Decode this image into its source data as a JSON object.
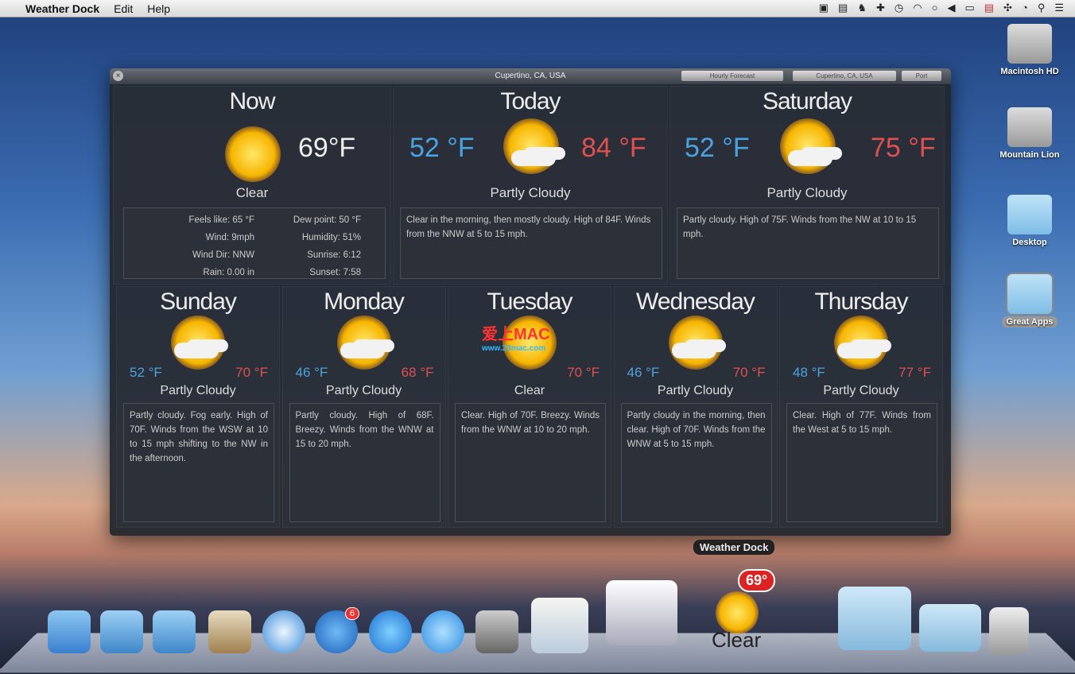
{
  "menubar": {
    "app": "Weather Dock",
    "items": [
      "Edit",
      "Help"
    ],
    "status_icons": [
      "airplay-icon",
      "disk-icon",
      "evernote-icon",
      "plus-icon",
      "time-machine-icon",
      "wifi-icon",
      "chat-icon",
      "volume-icon",
      "battery-icon",
      "flag-icon",
      "move-icon",
      "clock-icon",
      "search-icon",
      "list-icon"
    ]
  },
  "window": {
    "title": "Cupertino, CA, USA",
    "hourly_button": "Hourly Forecast",
    "location_select": "Cupertino, CA, USA",
    "port_button": "Port"
  },
  "now": {
    "label": "Now",
    "temp": "69°F",
    "condition": "Clear",
    "details": [
      [
        "Feels like: 65 °F",
        "Dew point: 50 °F"
      ],
      [
        "Wind: 9mph",
        "Humidity: 51%"
      ],
      [
        "Wind Dir: NNW",
        "Sunrise: 6:12"
      ],
      [
        "Rain: 0.00 in",
        "Sunset: 7:58"
      ]
    ]
  },
  "today": {
    "label": "Today",
    "low": "52 °F",
    "high": "84 °F",
    "condition": "Partly Cloudy",
    "desc": "Clear in the morning, then mostly cloudy. High of 84F. Winds from the NNW at 5 to 15 mph."
  },
  "saturday": {
    "label": "Saturday",
    "low": "52 °F",
    "high": "75 °F",
    "condition": "Partly Cloudy",
    "desc": "Partly cloudy. High of 75F. Winds from the NW at 10 to 15 mph."
  },
  "days": [
    {
      "label": "Sunday",
      "low": "52 °F",
      "high": "70 °F",
      "condition": "Partly Cloudy",
      "desc": "Partly cloudy. Fog early. High of 70F. Winds from the WSW at 10 to 15 mph shifting to the NW in the afternoon."
    },
    {
      "label": "Monday",
      "low": "46 °F",
      "high": "68 °F",
      "condition": "Partly Cloudy",
      "desc": "Partly cloudy. High of 68F. Breezy. Winds from the WNW at 15 to 20 mph."
    },
    {
      "label": "Tuesday",
      "low": "",
      "high": "70 °F",
      "condition": "Clear",
      "desc": "Clear. High of 70F. Breezy. Winds from the WNW at 10 to 20 mph."
    },
    {
      "label": "Wednesday",
      "low": "46 °F",
      "high": "70 °F",
      "condition": "Partly Cloudy",
      "desc": "Partly cloudy in the morning, then clear. High of 70F. Winds from the WNW at 5 to 15 mph."
    },
    {
      "label": "Thursday",
      "low": "48 °F",
      "high": "77 °F",
      "condition": "Partly Cloudy",
      "desc": "Clear. High of 77F. Winds from the West at 5 to 15 mph."
    }
  ],
  "watermark": "爱上MAC www.23mac.com",
  "dock": {
    "tooltip": "Weather Dock",
    "badge_temp": "69°",
    "condition": "Clear",
    "appstore_badge": "6"
  },
  "desktop": [
    "Macintosh HD",
    "Mountain Lion",
    "Desktop",
    "Great Apps"
  ]
}
